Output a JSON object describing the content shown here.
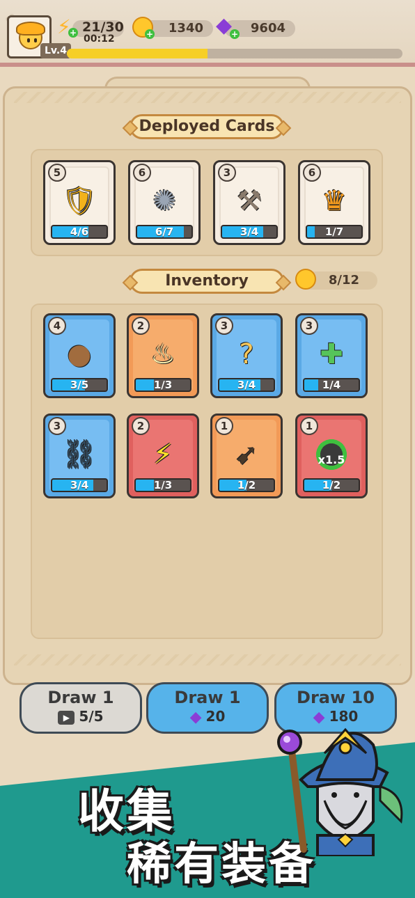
{
  "header": {
    "level": "Lv.4",
    "energy": "21/30",
    "energy_timer": "00:12",
    "coins": "1340",
    "gems": "9604",
    "xp_progress": 0.42
  },
  "deployed": {
    "title": "Deployed Cards",
    "cards": [
      {
        "cost": "5",
        "progress": "4/6",
        "fill": 0.67,
        "color": "white",
        "icon": "shield-plus-icon"
      },
      {
        "cost": "6",
        "progress": "6/7",
        "fill": 0.86,
        "color": "white",
        "icon": "wreath-gem-icon"
      },
      {
        "cost": "3",
        "progress": "3/4",
        "fill": 0.75,
        "color": "white",
        "icon": "hammer-upgrade-icon"
      },
      {
        "cost": "6",
        "progress": "1/7",
        "fill": 0.14,
        "color": "white",
        "icon": "level-up-hero-icon"
      }
    ]
  },
  "inventory": {
    "title": "Inventory",
    "count": "8/12",
    "cards": [
      {
        "cost": "4",
        "progress": "3/5",
        "fill": 0.6,
        "color": "blue",
        "icon": "money-bag-icon"
      },
      {
        "cost": "2",
        "progress": "1/3",
        "fill": 0.33,
        "color": "orange",
        "icon": "fire-hero-icon"
      },
      {
        "cost": "3",
        "progress": "3/4",
        "fill": 0.75,
        "color": "blue",
        "icon": "mystery-hero-icon"
      },
      {
        "cost": "3",
        "progress": "1/4",
        "fill": 0.25,
        "color": "blue",
        "icon": "heal-potion-icon"
      },
      {
        "cost": "3",
        "progress": "3/4",
        "fill": 0.75,
        "color": "blue",
        "icon": "chain-lightning-icon"
      },
      {
        "cost": "2",
        "progress": "1/3",
        "fill": 0.33,
        "color": "red",
        "icon": "lightning-icon"
      },
      {
        "cost": "1",
        "progress": "1/2",
        "fill": 0.5,
        "color": "orange",
        "icon": "dash-hero-icon"
      },
      {
        "cost": "1",
        "progress": "1/2",
        "fill": 0.5,
        "color": "red",
        "icon": "speed-x15-icon"
      }
    ]
  },
  "draw": {
    "draw1_free": {
      "label": "Draw 1",
      "cost": "5/5"
    },
    "draw1_gem": {
      "label": "Draw 1",
      "cost": "20"
    },
    "draw10_gem": {
      "label": "Draw 10",
      "cost": "180"
    }
  },
  "promo": {
    "line1": "收集",
    "line2": "稀有装备",
    "speed_label": "x1.5"
  }
}
